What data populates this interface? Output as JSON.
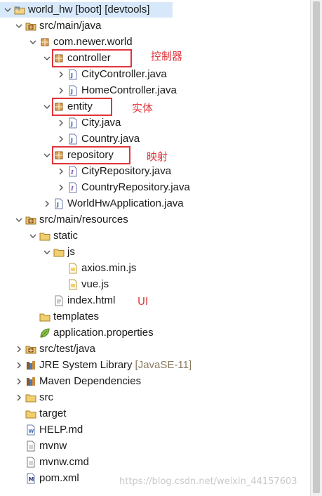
{
  "tree": {
    "project": "world_hw [boot] [devtools]",
    "src_main_java": "src/main/java",
    "package": "com.newer.world",
    "controller": "controller",
    "city_controller": "CityController.java",
    "home_controller": "HomeController.java",
    "entity": "entity",
    "city_java": "City.java",
    "country_java": "Country.java",
    "repository": "repository",
    "city_repository": "CityRepository.java",
    "country_repository": "CountryRepository.java",
    "app_java": "WorldHwApplication.java",
    "src_main_resources": "src/main/resources",
    "static": "static",
    "js": "js",
    "axios": "axios.min.js",
    "vue": "vue.js",
    "index": "index.html",
    "templates": "templates",
    "app_props": "application.properties",
    "src_test_java": "src/test/java",
    "jre_label": "JRE System Library",
    "jre_version": "[JavaSE-11]",
    "maven": "Maven Dependencies",
    "src": "src",
    "target": "target",
    "help": "HELP.md",
    "mvnw": "mvnw",
    "mvnw_cmd": "mvnw.cmd",
    "pom": "pom.xml"
  },
  "annotations": {
    "controller": "控制器",
    "entity": "实体",
    "repository": "映射",
    "ui": "UI"
  },
  "watermark": "https://blog.csdn.net/weixin_44157603",
  "colors": {
    "highlight": "#e0353b",
    "selection": "#d6e8f9",
    "jre_version": "#8b7b63"
  }
}
